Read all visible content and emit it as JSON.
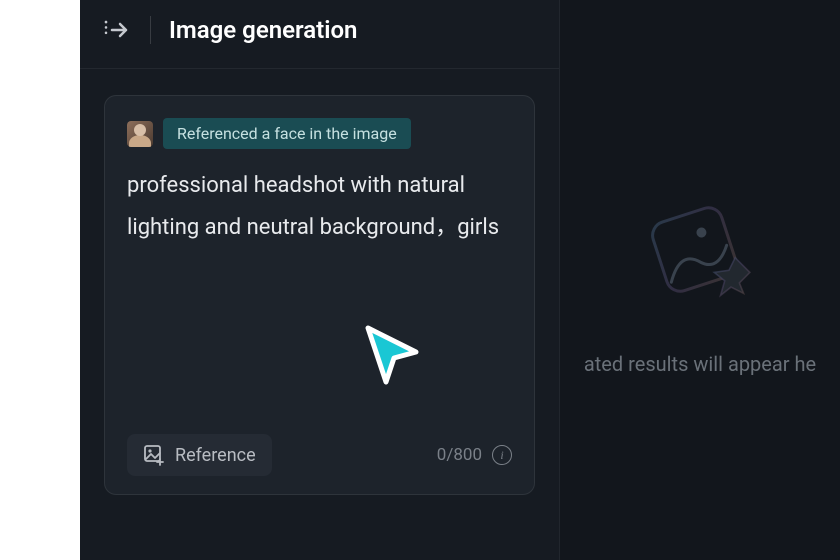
{
  "header": {
    "title": "Image generation"
  },
  "prompt_card": {
    "reference_chip_label": "Referenced a face in the image",
    "prompt_text": "professional headshot with natural lighting and neutral background，girls",
    "reference_button_label": "Reference",
    "char_count": "0/800"
  },
  "right_panel": {
    "empty_state_text": "ated results will appear he"
  }
}
